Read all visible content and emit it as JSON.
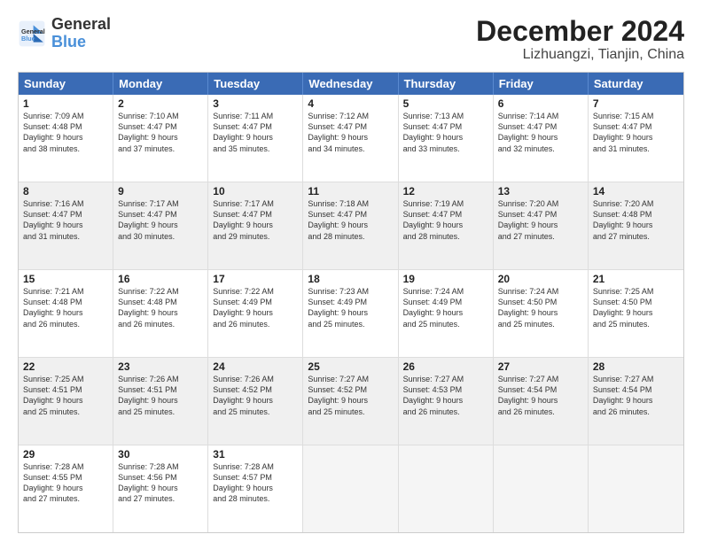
{
  "logo": {
    "general": "General",
    "blue": "Blue"
  },
  "title": "December 2024",
  "subtitle": "Lizhuangzi, Tianjin, China",
  "days": [
    "Sunday",
    "Monday",
    "Tuesday",
    "Wednesday",
    "Thursday",
    "Friday",
    "Saturday"
  ],
  "weeks": [
    [
      {
        "day": "1",
        "lines": [
          "Sunrise: 7:09 AM",
          "Sunset: 4:48 PM",
          "Daylight: 9 hours",
          "and 38 minutes."
        ]
      },
      {
        "day": "2",
        "lines": [
          "Sunrise: 7:10 AM",
          "Sunset: 4:47 PM",
          "Daylight: 9 hours",
          "and 37 minutes."
        ]
      },
      {
        "day": "3",
        "lines": [
          "Sunrise: 7:11 AM",
          "Sunset: 4:47 PM",
          "Daylight: 9 hours",
          "and 35 minutes."
        ]
      },
      {
        "day": "4",
        "lines": [
          "Sunrise: 7:12 AM",
          "Sunset: 4:47 PM",
          "Daylight: 9 hours",
          "and 34 minutes."
        ]
      },
      {
        "day": "5",
        "lines": [
          "Sunrise: 7:13 AM",
          "Sunset: 4:47 PM",
          "Daylight: 9 hours",
          "and 33 minutes."
        ]
      },
      {
        "day": "6",
        "lines": [
          "Sunrise: 7:14 AM",
          "Sunset: 4:47 PM",
          "Daylight: 9 hours",
          "and 32 minutes."
        ]
      },
      {
        "day": "7",
        "lines": [
          "Sunrise: 7:15 AM",
          "Sunset: 4:47 PM",
          "Daylight: 9 hours",
          "and 31 minutes."
        ]
      }
    ],
    [
      {
        "day": "8",
        "lines": [
          "Sunrise: 7:16 AM",
          "Sunset: 4:47 PM",
          "Daylight: 9 hours",
          "and 31 minutes."
        ]
      },
      {
        "day": "9",
        "lines": [
          "Sunrise: 7:17 AM",
          "Sunset: 4:47 PM",
          "Daylight: 9 hours",
          "and 30 minutes."
        ]
      },
      {
        "day": "10",
        "lines": [
          "Sunrise: 7:17 AM",
          "Sunset: 4:47 PM",
          "Daylight: 9 hours",
          "and 29 minutes."
        ]
      },
      {
        "day": "11",
        "lines": [
          "Sunrise: 7:18 AM",
          "Sunset: 4:47 PM",
          "Daylight: 9 hours",
          "and 28 minutes."
        ]
      },
      {
        "day": "12",
        "lines": [
          "Sunrise: 7:19 AM",
          "Sunset: 4:47 PM",
          "Daylight: 9 hours",
          "and 28 minutes."
        ]
      },
      {
        "day": "13",
        "lines": [
          "Sunrise: 7:20 AM",
          "Sunset: 4:47 PM",
          "Daylight: 9 hours",
          "and 27 minutes."
        ]
      },
      {
        "day": "14",
        "lines": [
          "Sunrise: 7:20 AM",
          "Sunset: 4:48 PM",
          "Daylight: 9 hours",
          "and 27 minutes."
        ]
      }
    ],
    [
      {
        "day": "15",
        "lines": [
          "Sunrise: 7:21 AM",
          "Sunset: 4:48 PM",
          "Daylight: 9 hours",
          "and 26 minutes."
        ]
      },
      {
        "day": "16",
        "lines": [
          "Sunrise: 7:22 AM",
          "Sunset: 4:48 PM",
          "Daylight: 9 hours",
          "and 26 minutes."
        ]
      },
      {
        "day": "17",
        "lines": [
          "Sunrise: 7:22 AM",
          "Sunset: 4:49 PM",
          "Daylight: 9 hours",
          "and 26 minutes."
        ]
      },
      {
        "day": "18",
        "lines": [
          "Sunrise: 7:23 AM",
          "Sunset: 4:49 PM",
          "Daylight: 9 hours",
          "and 25 minutes."
        ]
      },
      {
        "day": "19",
        "lines": [
          "Sunrise: 7:24 AM",
          "Sunset: 4:49 PM",
          "Daylight: 9 hours",
          "and 25 minutes."
        ]
      },
      {
        "day": "20",
        "lines": [
          "Sunrise: 7:24 AM",
          "Sunset: 4:50 PM",
          "Daylight: 9 hours",
          "and 25 minutes."
        ]
      },
      {
        "day": "21",
        "lines": [
          "Sunrise: 7:25 AM",
          "Sunset: 4:50 PM",
          "Daylight: 9 hours",
          "and 25 minutes."
        ]
      }
    ],
    [
      {
        "day": "22",
        "lines": [
          "Sunrise: 7:25 AM",
          "Sunset: 4:51 PM",
          "Daylight: 9 hours",
          "and 25 minutes."
        ]
      },
      {
        "day": "23",
        "lines": [
          "Sunrise: 7:26 AM",
          "Sunset: 4:51 PM",
          "Daylight: 9 hours",
          "and 25 minutes."
        ]
      },
      {
        "day": "24",
        "lines": [
          "Sunrise: 7:26 AM",
          "Sunset: 4:52 PM",
          "Daylight: 9 hours",
          "and 25 minutes."
        ]
      },
      {
        "day": "25",
        "lines": [
          "Sunrise: 7:27 AM",
          "Sunset: 4:52 PM",
          "Daylight: 9 hours",
          "and 25 minutes."
        ]
      },
      {
        "day": "26",
        "lines": [
          "Sunrise: 7:27 AM",
          "Sunset: 4:53 PM",
          "Daylight: 9 hours",
          "and 26 minutes."
        ]
      },
      {
        "day": "27",
        "lines": [
          "Sunrise: 7:27 AM",
          "Sunset: 4:54 PM",
          "Daylight: 9 hours",
          "and 26 minutes."
        ]
      },
      {
        "day": "28",
        "lines": [
          "Sunrise: 7:27 AM",
          "Sunset: 4:54 PM",
          "Daylight: 9 hours",
          "and 26 minutes."
        ]
      }
    ],
    [
      {
        "day": "29",
        "lines": [
          "Sunrise: 7:28 AM",
          "Sunset: 4:55 PM",
          "Daylight: 9 hours",
          "and 27 minutes."
        ]
      },
      {
        "day": "30",
        "lines": [
          "Sunrise: 7:28 AM",
          "Sunset: 4:56 PM",
          "Daylight: 9 hours",
          "and 27 minutes."
        ]
      },
      {
        "day": "31",
        "lines": [
          "Sunrise: 7:28 AM",
          "Sunset: 4:57 PM",
          "Daylight: 9 hours",
          "and 28 minutes."
        ]
      },
      null,
      null,
      null,
      null
    ]
  ]
}
